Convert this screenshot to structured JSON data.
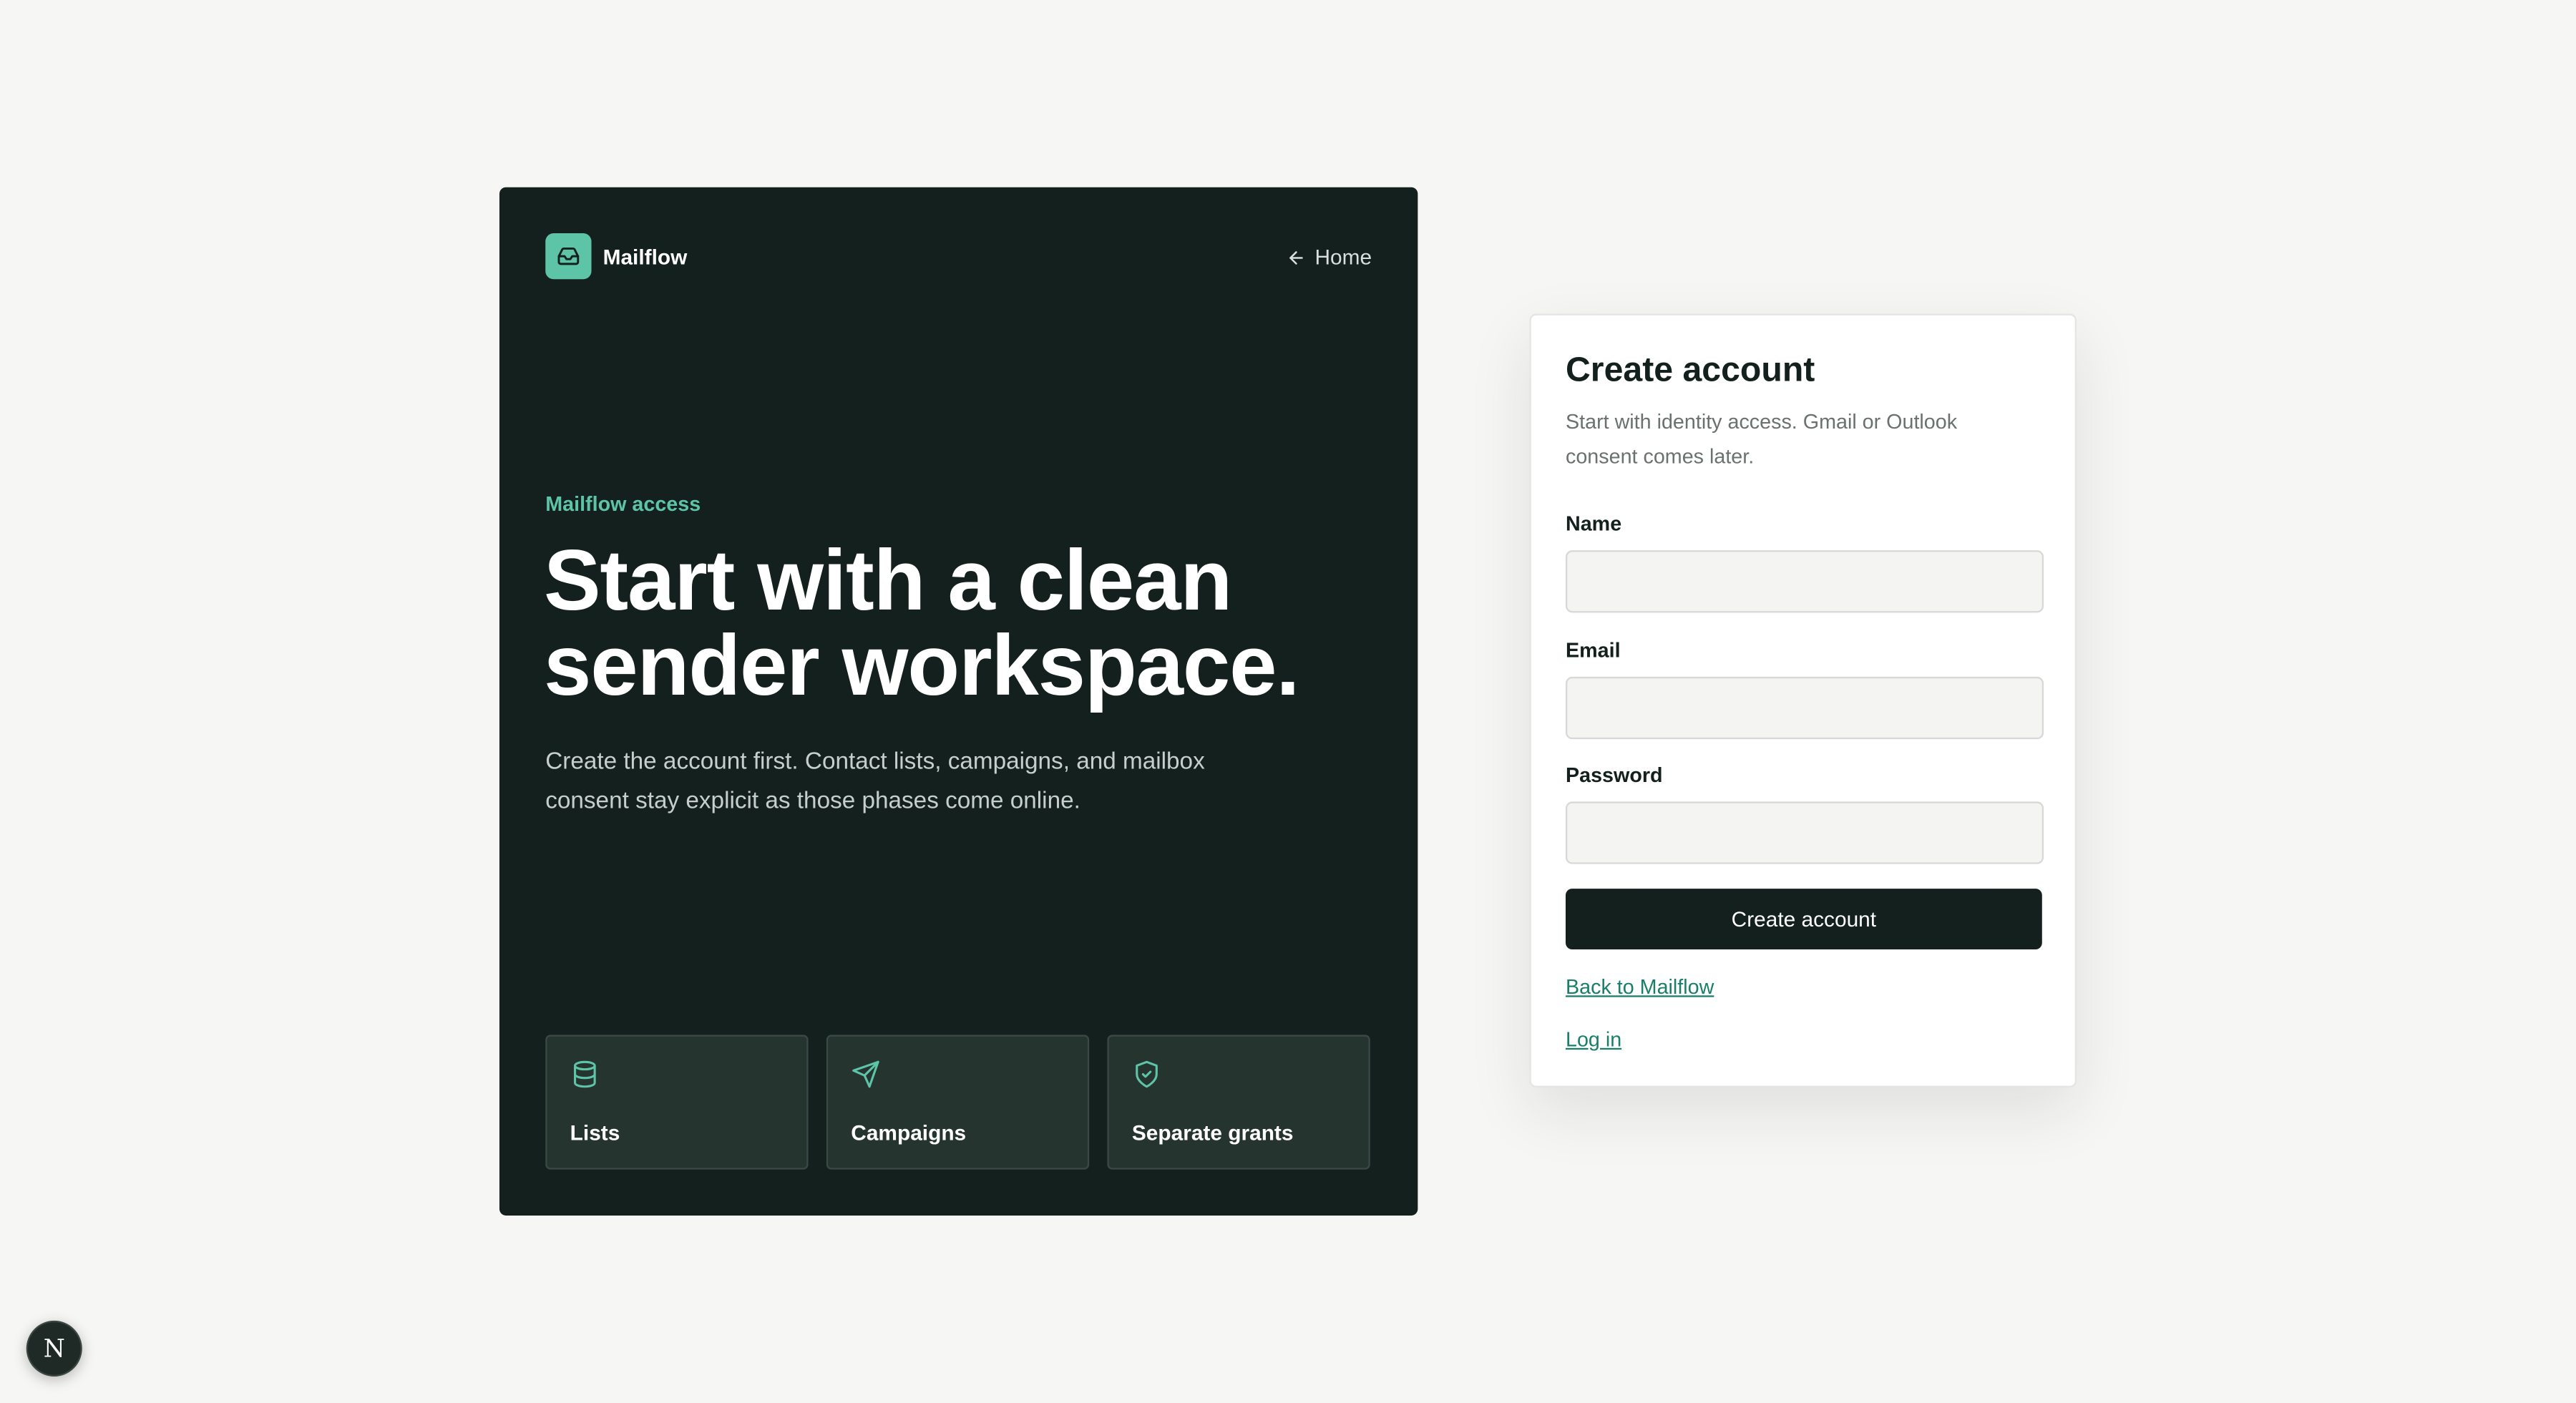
{
  "brand": {
    "name": "Mailflow",
    "icon": "inbox-icon",
    "accent_color": "#5ec4a8"
  },
  "nav": {
    "home_label": "Home"
  },
  "hero": {
    "eyebrow": "Mailflow access",
    "headline": "Start with a clean\nsender workspace.",
    "description": "Create the account first. Contact lists, campaigns, and mailbox consent stay explicit as those phases come online.",
    "background_color": "#13201d",
    "features": [
      {
        "label": "Lists",
        "icon": "database-icon"
      },
      {
        "label": "Campaigns",
        "icon": "send-icon"
      },
      {
        "label": "Separate grants",
        "icon": "shield-check-icon"
      }
    ]
  },
  "form": {
    "title": "Create account",
    "subtitle": "Start with identity access. Gmail or Outlook consent comes later.",
    "fields": [
      {
        "label": "Name",
        "value": "",
        "placeholder": ""
      },
      {
        "label": "Email",
        "value": "",
        "placeholder": ""
      },
      {
        "label": "Password",
        "value": "",
        "placeholder": ""
      }
    ],
    "submit_label": "Create account",
    "back_link": "Back to Mailflow",
    "login_link": "Log in"
  },
  "floating_button": {
    "label": "N"
  }
}
